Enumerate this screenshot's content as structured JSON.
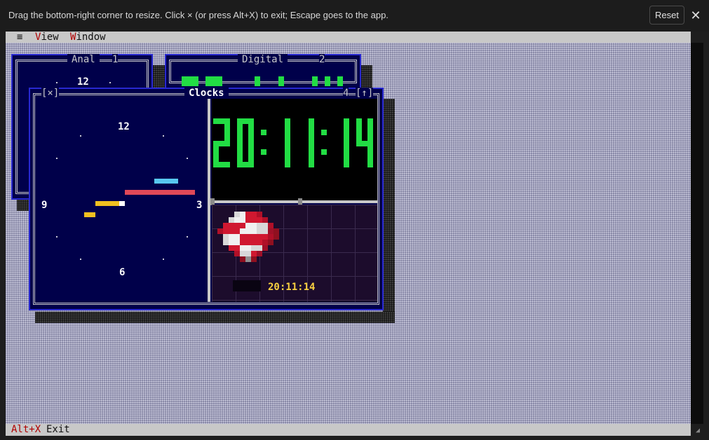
{
  "browser": {
    "hint": "Drag the bottom-right corner to resize. Click × (or press Alt+X) to exit; Escape goes to the app.",
    "reset_label": "Reset",
    "close_glyph": "✕"
  },
  "menubar": {
    "system_glyph": "≡",
    "items": [
      {
        "hotkey": "V",
        "rest": "iew"
      },
      {
        "hotkey": "W",
        "rest": "indow"
      }
    ]
  },
  "windows": {
    "analog": {
      "title": "Anal",
      "number": "1",
      "twelve": "12"
    },
    "digital": {
      "title": "Digital",
      "number": "2"
    },
    "clocks": {
      "title": "Clocks",
      "close_btn": "[×]",
      "number": "4",
      "zoom_btn": "[↑]",
      "dial": {
        "n12": "12",
        "n3": "3",
        "n6": "6",
        "n9": "9"
      },
      "digital_time": "20:11:14",
      "bottom_time": "20:11:14"
    }
  },
  "statusbar": {
    "hotkey": "Alt+X",
    "label": "Exit"
  },
  "colors": {
    "hour_hand": "#f0c020",
    "minute_hand": "#e04858",
    "second_hand": "#58c8f0",
    "digits": "#22dd44",
    "window_bg": "#00004a",
    "frame": "#2828d0",
    "ball_red": "#d01830",
    "time_yellow": "#f8d040"
  },
  "icons": {
    "ball": "checkered-ball-icon"
  }
}
